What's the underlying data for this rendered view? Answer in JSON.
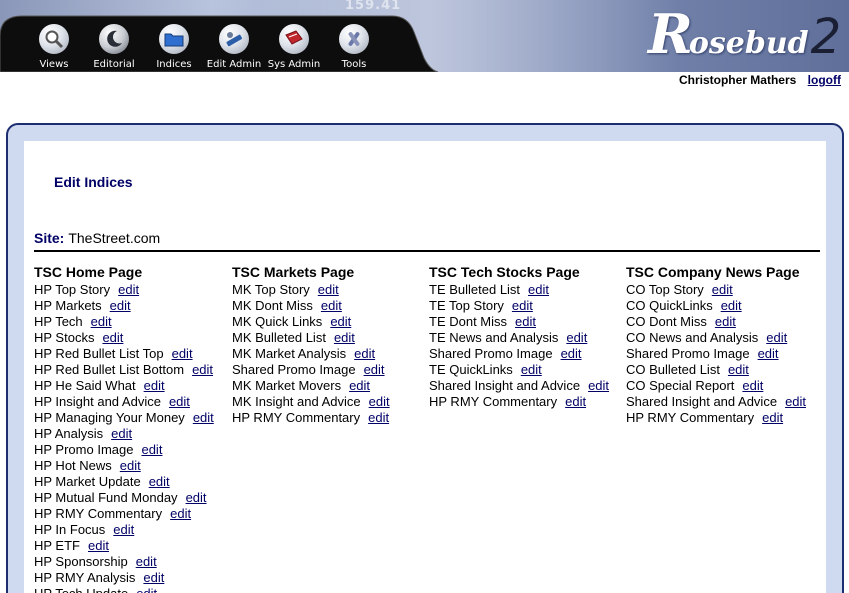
{
  "header": {
    "bg_digits": "159.41",
    "toolbar": [
      {
        "id": "views",
        "label": "Views",
        "icon": "magnifier-icon"
      },
      {
        "id": "editorial",
        "label": "Editorial",
        "icon": "moon-icon"
      },
      {
        "id": "indices",
        "label": "Indices",
        "icon": "folder-icon"
      },
      {
        "id": "edit-admin",
        "label": "Edit Admin",
        "icon": "tools-icon"
      },
      {
        "id": "sys-admin",
        "label": "Sys Admin",
        "icon": "book-icon"
      },
      {
        "id": "tools",
        "label": "Tools",
        "icon": "wrench-icon"
      }
    ],
    "logo": {
      "first": "R",
      "rest": "osebud",
      "num": "2"
    }
  },
  "user": {
    "name": "Christopher Mathers",
    "logoff": "logoff"
  },
  "page": {
    "title": "Edit Indices"
  },
  "site": {
    "label": "Site:",
    "value": "TheStreet.com"
  },
  "edit_label": "edit",
  "columns": [
    {
      "title": "TSC Home Page",
      "items": [
        "HP Top Story",
        "HP Markets",
        "HP Tech",
        "HP Stocks",
        "HP Red Bullet List Top",
        "HP Red Bullet List Bottom",
        "HP He Said What",
        "HP Insight and Advice",
        "HP Managing Your Money",
        "HP Analysis",
        "HP Promo Image",
        "HP Hot News",
        "HP Market Update",
        "HP Mutual Fund Monday",
        "HP RMY Commentary",
        "HP In Focus",
        "HP ETF",
        "HP Sponsorship",
        "HP RMY Analysis",
        "HP Tech Update"
      ]
    },
    {
      "title": "TSC Markets Page",
      "items": [
        "MK Top Story",
        "MK Dont Miss",
        "MK Quick Links",
        "MK Bulleted List",
        "MK Market Analysis",
        "Shared Promo Image",
        "MK Market Movers",
        "MK Insight and Advice",
        "HP RMY Commentary"
      ]
    },
    {
      "title": "TSC Tech Stocks Page",
      "items": [
        "TE Bulleted List",
        "TE Top Story",
        "TE Dont Miss",
        "TE News and Analysis",
        "Shared Promo Image",
        "TE QuickLinks",
        "Shared Insight and Advice",
        "HP RMY Commentary"
      ]
    },
    {
      "title": "TSC Company News Page",
      "items": [
        "CO Top Story",
        "CO QuickLinks",
        "CO Dont Miss",
        "CO News and Analysis",
        "Shared Promo Image",
        "CO Bulleted List",
        "CO Special Report",
        "Shared Insight and Advice",
        "HP RMY Commentary"
      ]
    }
  ]
}
